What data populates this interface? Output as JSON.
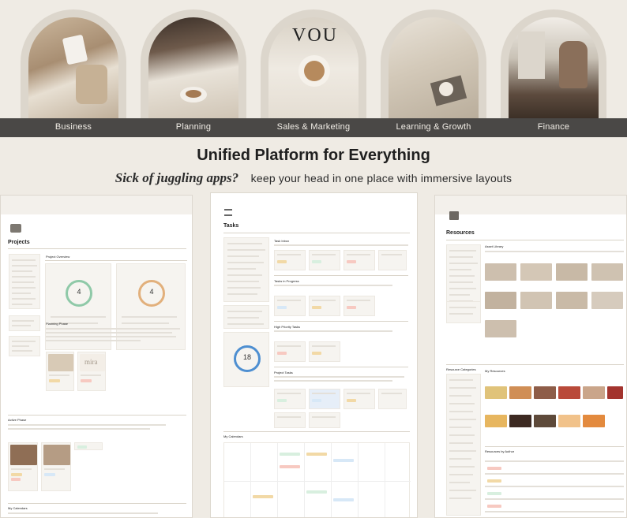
{
  "categories": [
    "Business",
    "Planning",
    "Sales & Marketing",
    "Learning & Growth",
    "Finance"
  ],
  "headline": "Unified Platform for Everything",
  "subheadline": {
    "emphasis": "Sick of juggling apps?",
    "rest": "keep your head in one place with immersive layouts"
  },
  "panels": {
    "projects": {
      "title": "Projects",
      "overview_label": "Project Overview",
      "ring_left": "4",
      "ring_right": "4",
      "planning_label": "Planning Phase",
      "active_label": "Active Phase",
      "calendar_label": "My Calendars",
      "card_word": "mira"
    },
    "tasks": {
      "title": "Tasks",
      "sections": [
        "Task Inbox",
        "Tasks in Progress",
        "High Priority Tasks",
        "Project Tasks"
      ],
      "ring_value": "18",
      "calendar_label": "My Calendars"
    },
    "resources": {
      "title": "Resources",
      "asset_library": "Asset Library",
      "categories_label": "Resource Categories",
      "my_resources": "My Resources",
      "by_author": "Resources by Author"
    }
  },
  "colors": {
    "cat_bar": "#4a4846",
    "background": "#efebe4",
    "ring_green": "#8fc9a8",
    "ring_orange": "#e2b07c",
    "ring_blue": "#4e8fd1",
    "accent_blue": "#3d7fd6"
  }
}
